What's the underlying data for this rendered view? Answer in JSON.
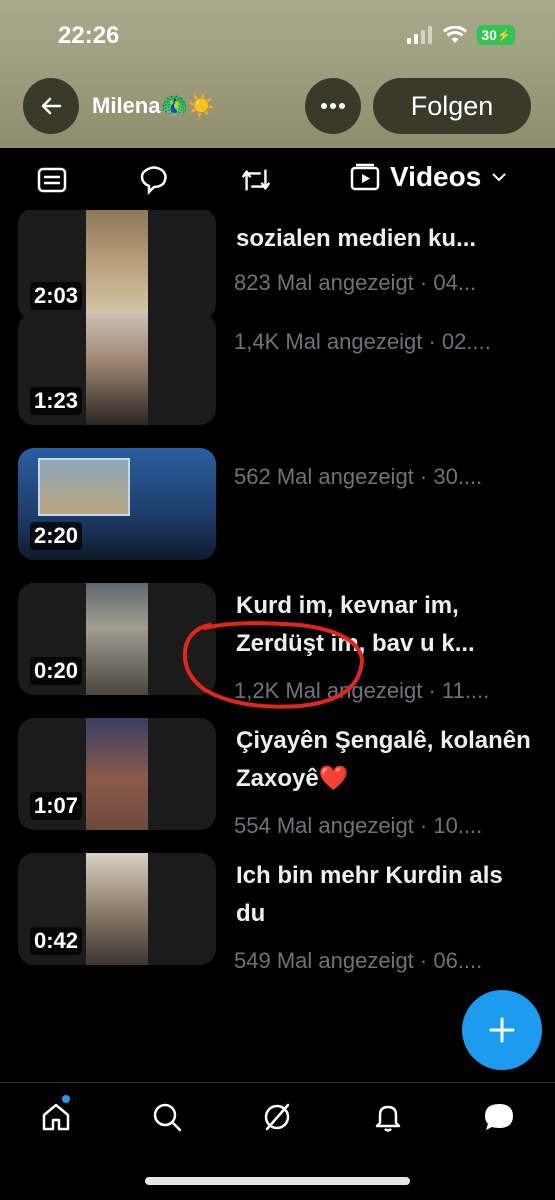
{
  "status_bar": {
    "time": "22:26",
    "battery": "30"
  },
  "header": {
    "profile_name": "Milena🦚☀️",
    "follow_label": "Folgen"
  },
  "tabs": {
    "active_label": "Videos"
  },
  "videos": [
    {
      "duration": "2:03",
      "title": "sozialen medien ku...",
      "meta": "823 Mal angezeigt · 04..."
    },
    {
      "duration": "1:23",
      "title": "",
      "meta": "1,4K Mal angezeigt · 02...."
    },
    {
      "duration": "2:20",
      "title": "",
      "meta": "562 Mal angezeigt · 30...."
    },
    {
      "duration": "0:20",
      "title": "Kurd im, kevnar im, Zerdüşt im, bav u k...",
      "meta": "1,2K Mal angezeigt · 11...."
    },
    {
      "duration": "1:07",
      "title": "Çiyayên Şengalê, kolanên Zaxoyê❤️",
      "meta": "554 Mal angezeigt · 10...."
    },
    {
      "duration": "0:42",
      "title": "Ich bin mehr Kurdin als du",
      "meta": "549 Mal angezeigt · 06...."
    }
  ],
  "colors": {
    "accent": "#1d9bf0",
    "annotation": "#e0271e"
  }
}
